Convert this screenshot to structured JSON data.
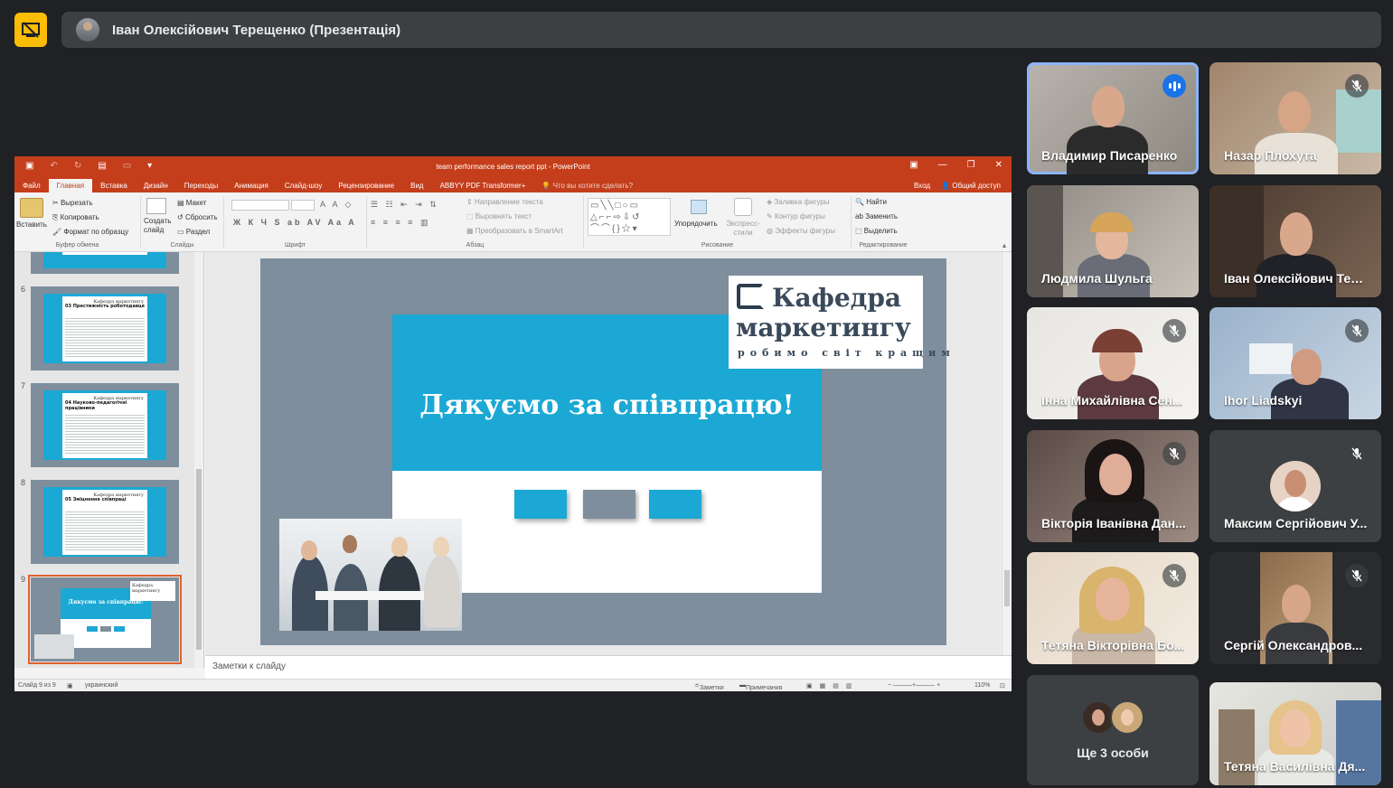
{
  "meeting": {
    "presenter_title": "Іван Олексійович Терещенко (Презентація)"
  },
  "powerpoint": {
    "doc_title": "team performance sales report ppt - PowerPoint",
    "tabs": [
      "Файл",
      "Главная",
      "Вставка",
      "Дизайн",
      "Переходы",
      "Анимация",
      "Слайд-шоу",
      "Рецензирование",
      "Вид",
      "ABBYY PDF Transformer+"
    ],
    "active_tab": "Главная",
    "tell_me": "Что вы хотите сделать?",
    "sign_in": "Вход",
    "share": "Общий доступ",
    "ribbon": {
      "paste": "Вставить",
      "cut": "Вырезать",
      "copy": "Копировать",
      "format_painter": "Формат по образцу",
      "clipboard_group": "Буфер обмена",
      "new_slide": "Создать слайд",
      "layout": "Макет",
      "reset": "Сбросить",
      "section": "Раздел",
      "slides_group": "Слайды",
      "font_group": "Шрифт",
      "text_direction": "Направление текста",
      "align_text": "Выровнять текст",
      "smartart": "Преобразовать в SmartArt",
      "paragraph_group": "Абзац",
      "arrange": "Упорядочить",
      "quick_styles": "Экспресс-стили",
      "shape_fill": "Заливка фигуры",
      "shape_outline": "Контур фигуры",
      "shape_effects": "Эффекты фигуры",
      "drawing_group": "Рисование",
      "find": "Найти",
      "replace": "Заменить",
      "select": "Выделить",
      "editing_group": "Редактирование"
    },
    "thumbnails": [
      {
        "num": "6",
        "title": "03 Престижність роботодавця"
      },
      {
        "num": "7",
        "title": "04 Науково-педагогічні працівники"
      },
      {
        "num": "8",
        "title": "05 Зміцнення співпраці"
      },
      {
        "num": "9",
        "title": "Дякуємо за співпрацю!"
      }
    ],
    "thumb_logo": "Кафедра маркетингу",
    "slide": {
      "heading": "Дякуємо за співпрацю!",
      "logo_line1": "Кафедра",
      "logo_line2": "маркетингу",
      "logo_tagline": "робимо світ кращим"
    },
    "notes_placeholder": "Заметки к слайду",
    "status": {
      "slide_counter": "Слайд 9 из 9",
      "language": "украинский",
      "notes": "Заметки",
      "comments": "Примечания",
      "zoom": "110%"
    },
    "colors": {
      "accent": "#c43e1c",
      "slide_blue": "#1ba8d4",
      "slide_grey": "#7e8e9d"
    }
  },
  "participants": [
    {
      "name": "Владимир Писаренко",
      "state": "speaking"
    },
    {
      "name": "Назар Плохута",
      "state": "muted"
    },
    {
      "name": "Людмила Шульга",
      "state": "none"
    },
    {
      "name": "Іван Олексійович Тер...",
      "state": "none"
    },
    {
      "name": "Інна Михайлівна Сен...",
      "state": "muted"
    },
    {
      "name": "Ihor Liadskyi",
      "state": "muted"
    },
    {
      "name": "Вікторія Іванівна Дан...",
      "state": "muted"
    },
    {
      "name": "Максим Сергійович У...",
      "state": "muted"
    },
    {
      "name": "Тетяна Вікторівна Бо...",
      "state": "muted"
    },
    {
      "name": "Сергій Олександров...",
      "state": "muted"
    },
    {
      "name": "Тетяна Василівна Дя...",
      "state": "none"
    }
  ],
  "more_participants": "Ще 3 особи"
}
